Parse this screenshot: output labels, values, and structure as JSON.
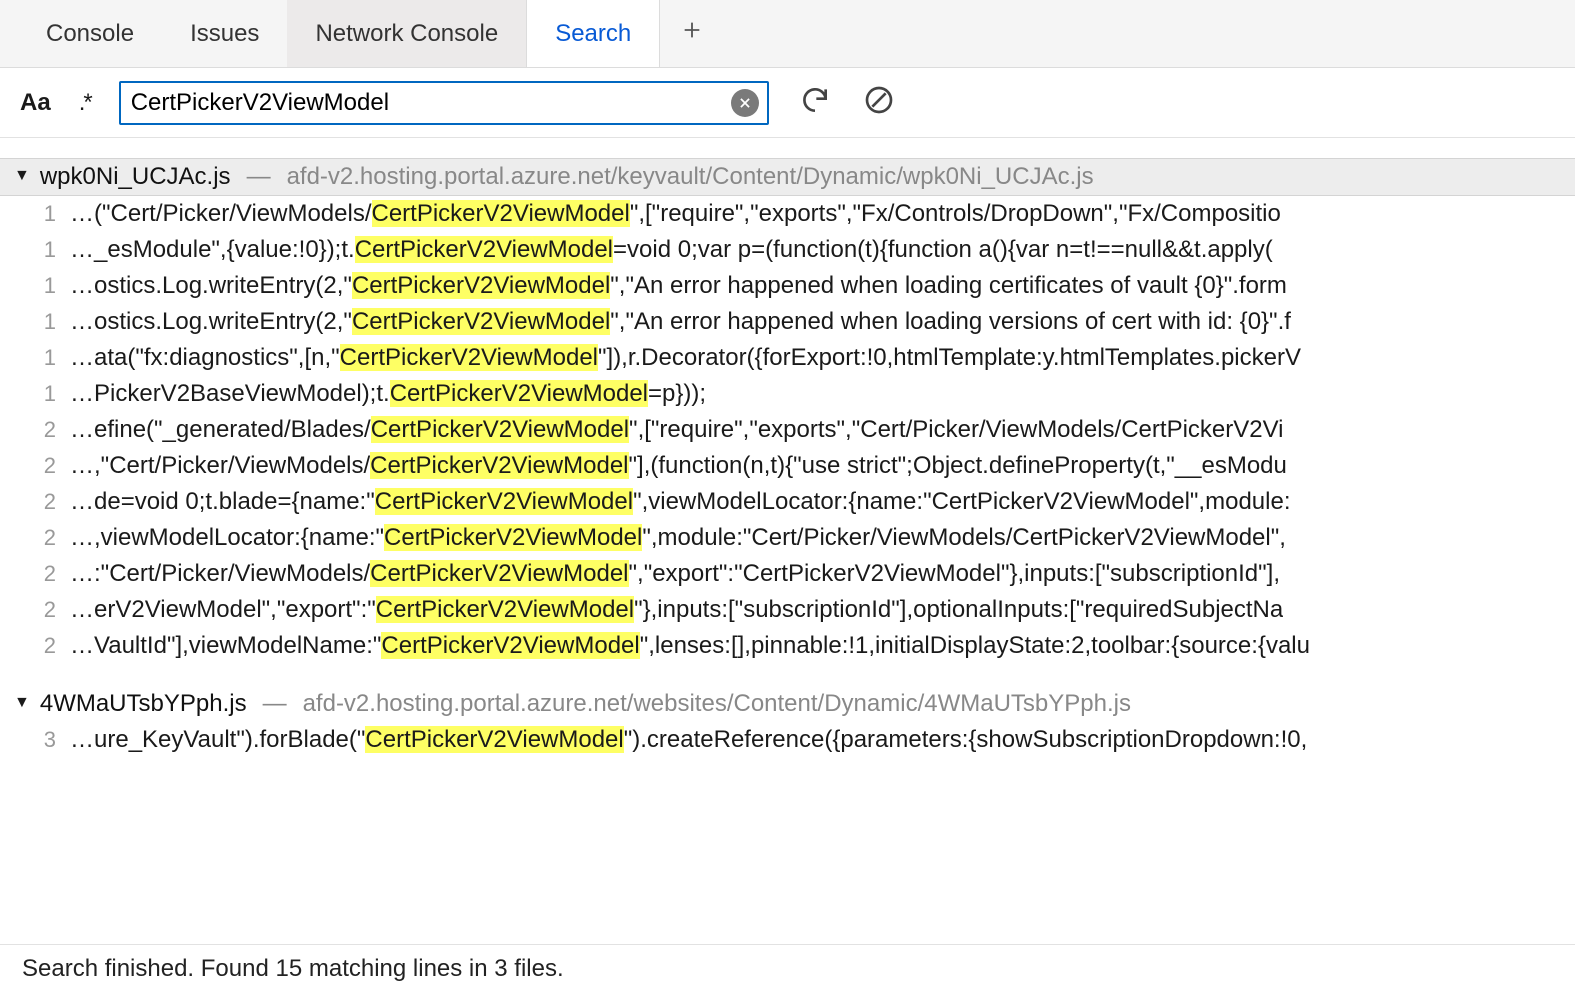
{
  "tabs": {
    "console": "Console",
    "issues": "Issues",
    "network": "Network Console",
    "search": "Search"
  },
  "toolbar": {
    "case_label": "Aa",
    "regex_label": ".*",
    "search_value": "CertPickerV2ViewModel"
  },
  "files": [
    {
      "name": "wpk0Ni_UCJAc.js",
      "path": "afd-v2.hosting.portal.azure.net/keyvault/Content/Dynamic/wpk0Ni_UCJAc.js",
      "shaded": true,
      "matches": [
        {
          "line": 1,
          "pre": "…(\"Cert/Picker/ViewModels/",
          "hit": "CertPickerV2ViewModel",
          "post": "\",[\"require\",\"exports\",\"Fx/Controls/DropDown\",\"Fx/Compositio"
        },
        {
          "line": 1,
          "pre": "…_esModule\",{value:!0});t.",
          "hit": "CertPickerV2ViewModel",
          "post": "=void 0;var p=(function(t){function a(){var n=t!==null&&t.apply("
        },
        {
          "line": 1,
          "pre": "…ostics.Log.writeEntry(2,\"",
          "hit": "CertPickerV2ViewModel",
          "post": "\",\"An error happened when loading certificates of vault {0}\".form"
        },
        {
          "line": 1,
          "pre": "…ostics.Log.writeEntry(2,\"",
          "hit": "CertPickerV2ViewModel",
          "post": "\",\"An error happened when loading versions of cert with id: {0}\".f"
        },
        {
          "line": 1,
          "pre": "…ata(\"fx:diagnostics\",[n,\"",
          "hit": "CertPickerV2ViewModel",
          "post": "\"]),r.Decorator({forExport:!0,htmlTemplate:y.htmlTemplates.pickerV"
        },
        {
          "line": 1,
          "pre": "…PickerV2BaseViewModel);t.",
          "hit": "CertPickerV2ViewModel",
          "post": "=p}));"
        },
        {
          "line": 2,
          "pre": "…efine(\"_generated/Blades/",
          "hit": "CertPickerV2ViewModel",
          "post": "\",[\"require\",\"exports\",\"Cert/Picker/ViewModels/CertPickerV2Vi"
        },
        {
          "line": 2,
          "pre": "…,\"Cert/Picker/ViewModels/",
          "hit": "CertPickerV2ViewModel",
          "post": "\"],(function(n,t){\"use strict\";Object.defineProperty(t,\"__esModu"
        },
        {
          "line": 2,
          "pre": "…de=void 0;t.blade={name:\"",
          "hit": "CertPickerV2ViewModel",
          "post": "\",viewModelLocator:{name:\"CertPickerV2ViewModel\",module:"
        },
        {
          "line": 2,
          "pre": "…,viewModelLocator:{name:\"",
          "hit": "CertPickerV2ViewModel",
          "post": "\",module:\"Cert/Picker/ViewModels/CertPickerV2ViewModel\","
        },
        {
          "line": 2,
          "pre": "…:\"Cert/Picker/ViewModels/",
          "hit": "CertPickerV2ViewModel",
          "post": "\",\"export\":\"CertPickerV2ViewModel\"},inputs:[\"subscriptionId\"],"
        },
        {
          "line": 2,
          "pre": "…erV2ViewModel\",\"export\":\"",
          "hit": "CertPickerV2ViewModel",
          "post": "\"},inputs:[\"subscriptionId\"],optionalInputs:[\"requiredSubjectNa"
        },
        {
          "line": 2,
          "pre": "…VaultId\"],viewModelName:\"",
          "hit": "CertPickerV2ViewModel",
          "post": "\",lenses:[],pinnable:!1,initialDisplayState:2,toolbar:{source:{valu"
        }
      ]
    },
    {
      "name": "4WMaUTsbYPph.js",
      "path": "afd-v2.hosting.portal.azure.net/websites/Content/Dynamic/4WMaUTsbYPph.js",
      "shaded": false,
      "matches": [
        {
          "line": 3,
          "pre": "…ure_KeyVault\").forBlade(\"",
          "hit": "CertPickerV2ViewModel",
          "post": "\").createReference({parameters:{showSubscriptionDropdown:!0,"
        }
      ]
    }
  ],
  "status": "Search finished.  Found 15 matching lines in 3 files."
}
